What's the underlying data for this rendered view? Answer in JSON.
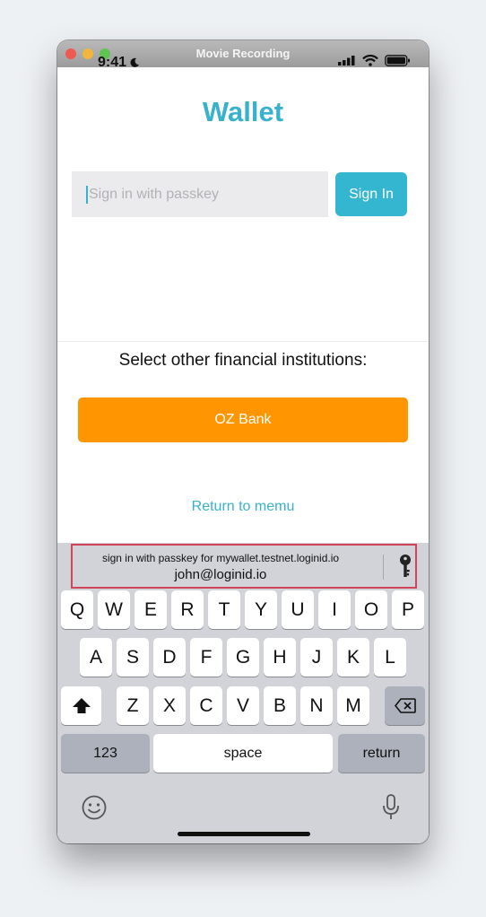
{
  "window": {
    "title": "Movie Recording"
  },
  "status_bar": {
    "time": "9:41"
  },
  "app": {
    "title": "Wallet",
    "passkey_placeholder": "Sign in with passkey",
    "sign_in_label": "Sign In",
    "institutions_label": "Select other financial institutions:",
    "oz_bank_label": "OZ Bank",
    "return_label": "Return to memu",
    "accent_color": "#38b1cc",
    "orange_color": "#ff9500"
  },
  "keyboard": {
    "suggestion": {
      "line1": "sign in with passkey for mywallet.testnet.loginid.io",
      "line2": "john@loginid.io"
    },
    "row1": [
      "Q",
      "W",
      "E",
      "R",
      "T",
      "Y",
      "U",
      "I",
      "O",
      "P"
    ],
    "row2": [
      "A",
      "S",
      "D",
      "F",
      "G",
      "H",
      "J",
      "K",
      "L"
    ],
    "row3": [
      "Z",
      "X",
      "C",
      "V",
      "B",
      "N",
      "M"
    ],
    "numbers_label": "123",
    "space_label": "space",
    "return_label": "return"
  }
}
